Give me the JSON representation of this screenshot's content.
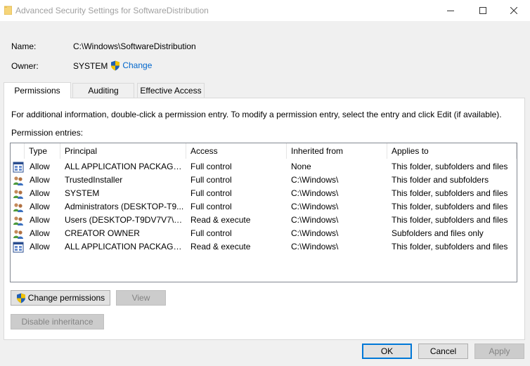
{
  "window": {
    "title": "Advanced Security Settings for SoftwareDistribution"
  },
  "header": {
    "name_label": "Name:",
    "name_value": "C:\\Windows\\SoftwareDistribution",
    "owner_label": "Owner:",
    "owner_value": "SYSTEM",
    "change_link": "Change"
  },
  "tabs": [
    {
      "label": "Permissions",
      "active": true
    },
    {
      "label": "Auditing",
      "active": false
    },
    {
      "label": "Effective Access",
      "active": false
    }
  ],
  "permissions": {
    "info_text": "For additional information, double-click a permission entry. To modify a permission entry, select the entry and click Edit (if available).",
    "entries_label": "Permission entries:",
    "columns": [
      "Type",
      "Principal",
      "Access",
      "Inherited from",
      "Applies to"
    ],
    "rows": [
      {
        "icon": "app-packages-icon",
        "type": "Allow",
        "principal": "ALL APPLICATION PACKAGES",
        "access": "Full control",
        "inherited": "None",
        "applies": "This folder, subfolders and files"
      },
      {
        "icon": "user-group-icon",
        "type": "Allow",
        "principal": "TrustedInstaller",
        "access": "Full control",
        "inherited": "C:\\Windows\\",
        "applies": "This folder and subfolders"
      },
      {
        "icon": "user-group-icon",
        "type": "Allow",
        "principal": "SYSTEM",
        "access": "Full control",
        "inherited": "C:\\Windows\\",
        "applies": "This folder, subfolders and files"
      },
      {
        "icon": "user-group-icon",
        "type": "Allow",
        "principal": "Administrators (DESKTOP-T9...",
        "access": "Full control",
        "inherited": "C:\\Windows\\",
        "applies": "This folder, subfolders and files"
      },
      {
        "icon": "user-group-icon",
        "type": "Allow",
        "principal": "Users (DESKTOP-T9DV7V7\\Us...",
        "access": "Read & execute",
        "inherited": "C:\\Windows\\",
        "applies": "This folder, subfolders and files"
      },
      {
        "icon": "user-group-icon",
        "type": "Allow",
        "principal": "CREATOR OWNER",
        "access": "Full control",
        "inherited": "C:\\Windows\\",
        "applies": "Subfolders and files only"
      },
      {
        "icon": "app-packages-icon",
        "type": "Allow",
        "principal": "ALL APPLICATION PACKAGES",
        "access": "Read & execute",
        "inherited": "C:\\Windows\\",
        "applies": "This folder, subfolders and files"
      }
    ],
    "change_permissions_label": "Change permissions",
    "view_label": "View",
    "disable_inheritance_label": "Disable inheritance"
  },
  "footer": {
    "ok_label": "OK",
    "cancel_label": "Cancel",
    "apply_label": "Apply"
  },
  "colors": {
    "link": "#0066cc",
    "accent": "#0078d7",
    "shield_blue": "#1f5fb5",
    "shield_yellow": "#f2c200"
  }
}
